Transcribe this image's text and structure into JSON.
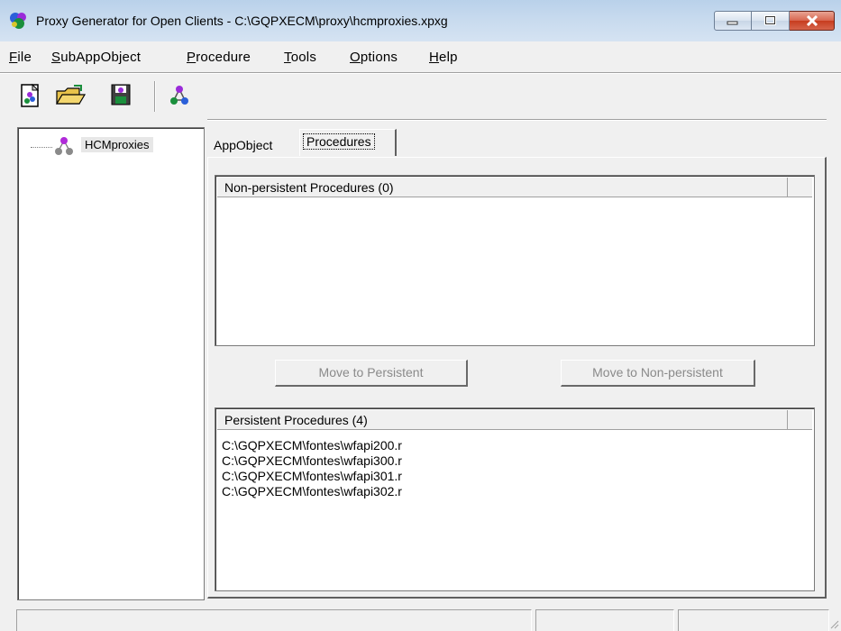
{
  "window": {
    "title": "Proxy Generator for Open Clients - C:\\GQPXECM\\proxy\\hcmproxies.xpxg"
  },
  "menu": [
    {
      "pre": "",
      "key": "F",
      "post": "ile"
    },
    {
      "pre": "",
      "key": "S",
      "post": "ubAppObject"
    },
    {
      "pre": "",
      "key": "P",
      "post": "rocedure"
    },
    {
      "pre": "",
      "key": "T",
      "post": "ools"
    },
    {
      "pre": "",
      "key": "O",
      "post": "ptions"
    },
    {
      "pre": "",
      "key": "H",
      "post": "elp"
    }
  ],
  "toolbar": {
    "icons": [
      "new-project-icon",
      "open-folder-icon",
      "save-disk-icon",
      "generate-proxy-icon"
    ]
  },
  "tree": {
    "root_label": "HCMproxies",
    "root_icon": "appobject-icon"
  },
  "tabs": [
    {
      "label": "AppObject",
      "selected": false
    },
    {
      "label": "Procedures",
      "selected": true
    }
  ],
  "nonpersistent": {
    "header": "Non-persistent Procedures (0)",
    "items": []
  },
  "buttons": {
    "move_to_persistent": "Move to Persistent",
    "move_to_nonpersistent": "Move to Non-persistent"
  },
  "persistent": {
    "header": "Persistent Procedures (4)",
    "items": [
      "C:\\GQPXECM\\fontes\\wfapi200.r",
      "C:\\GQPXECM\\fontes\\wfapi300.r",
      "C:\\GQPXECM\\fontes\\wfapi301.r",
      "C:\\GQPXECM\\fontes\\wfapi302.r"
    ]
  },
  "statusbar": {
    "main": "",
    "pane2": "",
    "pane3": ""
  },
  "colors": {
    "titlebar": "#c7daee",
    "close_button": "#c73c1f",
    "face": "#f0f0f0"
  }
}
